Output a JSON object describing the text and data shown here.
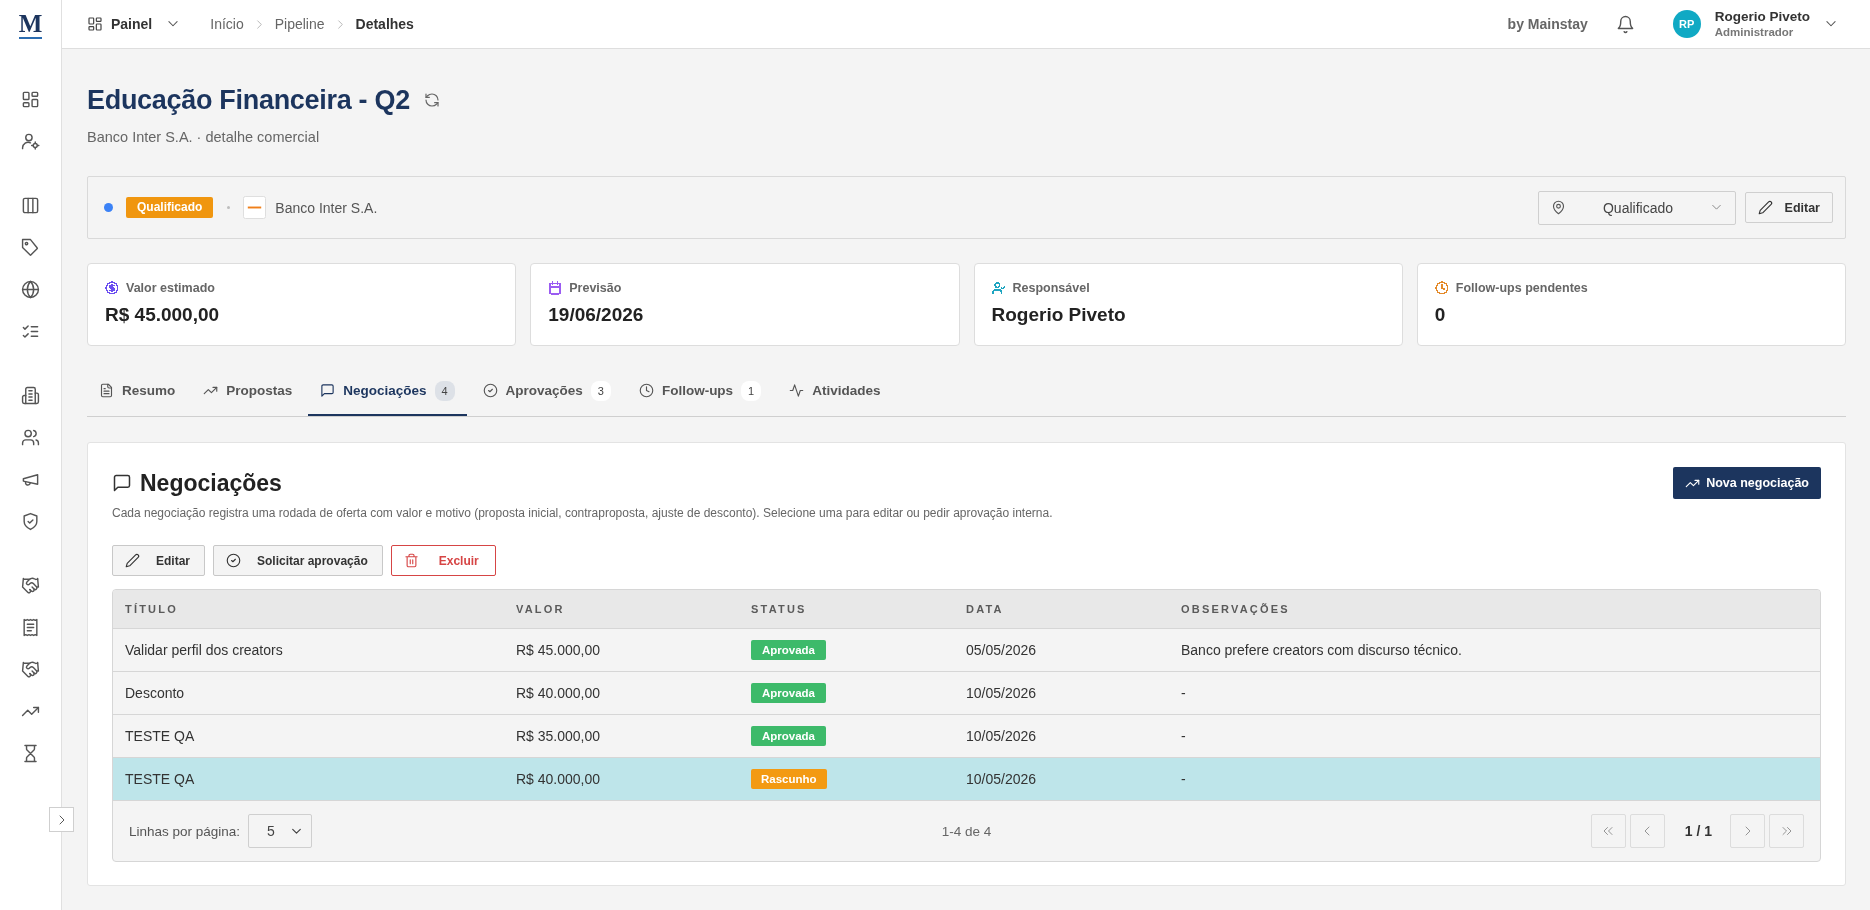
{
  "app": {
    "logo": "M"
  },
  "topbar": {
    "menu": {
      "label": "Painel"
    },
    "breadcrumb": [
      {
        "label": "Início",
        "current": false
      },
      {
        "label": "Pipeline",
        "current": false
      },
      {
        "label": "Detalhes",
        "current": true
      }
    ],
    "brand": "by Mainstay",
    "user": {
      "initials": "RP",
      "name": "Rogerio Piveto",
      "role": "Administrador"
    }
  },
  "header": {
    "title": "Educação Financeira - Q2",
    "subtitle": "Banco Inter S.A. · detalhe comercial"
  },
  "status_bar": {
    "badge": "Qualificado",
    "company": "Banco Inter S.A.",
    "stage_select": {
      "value": "Qualificado"
    },
    "edit_button": "Editar"
  },
  "cards": [
    {
      "label": "Valor estimado",
      "value": "R$ 45.000,00",
      "color": "#6b4ef0"
    },
    {
      "label": "Previsão",
      "value": "19/06/2026",
      "color": "#9b5cf2"
    },
    {
      "label": "Responsável",
      "value": "Rogerio Piveto",
      "color": "#1ea5c1"
    },
    {
      "label": "Follow-ups pendentes",
      "value": "0",
      "color": "#e48a2a"
    }
  ],
  "tabs": [
    {
      "label": "Resumo",
      "selected": false
    },
    {
      "label": "Propostas",
      "selected": false
    },
    {
      "label": "Negociações",
      "count": "4",
      "selected": true
    },
    {
      "label": "Aprovações",
      "count": "3",
      "selected": false
    },
    {
      "label": "Follow-ups",
      "count": "1",
      "selected": false
    },
    {
      "label": "Atividades",
      "selected": false
    }
  ],
  "panel": {
    "title": "Negociações",
    "description": "Cada negociação registra uma rodada de oferta com valor e motivo (proposta inicial, contraproposta, ajuste de desconto). Selecione uma para editar ou pedir aprovação interna.",
    "new_button": "Nova negociação",
    "actions": [
      {
        "label": "Editar",
        "kind": "default"
      },
      {
        "label": "Solicitar aprovação",
        "kind": "default"
      },
      {
        "label": "Excluir",
        "kind": "danger"
      }
    ]
  },
  "table": {
    "columns": [
      "TÍTULO",
      "VALOR",
      "STATUS",
      "DATA",
      "OBSERVAÇÕES"
    ],
    "rows": [
      {
        "title": "Validar perfil dos creators",
        "value": "R$ 45.000,00",
        "status": {
          "label": "Aprovada",
          "color": "#3dba6a"
        },
        "date": "05/05/2026",
        "notes": "Banco prefere creators com discurso técnico.",
        "selected": false
      },
      {
        "title": "Desconto",
        "value": "R$ 40.000,00",
        "status": {
          "label": "Aprovada",
          "color": "#3dba6a"
        },
        "date": "10/05/2026",
        "notes": "-",
        "selected": false
      },
      {
        "title": "TESTE QA",
        "value": "R$ 35.000,00",
        "status": {
          "label": "Aprovada",
          "color": "#3dba6a"
        },
        "date": "10/05/2026",
        "notes": "-",
        "selected": false
      },
      {
        "title": "TESTE QA",
        "value": "R$ 40.000,00",
        "status": {
          "label": "Rascunho",
          "color": "#f39a12"
        },
        "date": "10/05/2026",
        "notes": "-",
        "selected": true
      }
    ],
    "footer": {
      "rows_per_page_label": "Linhas por página:",
      "rows_per_page": "5",
      "range": "1-4 de 4",
      "page": "1 / 1"
    }
  }
}
